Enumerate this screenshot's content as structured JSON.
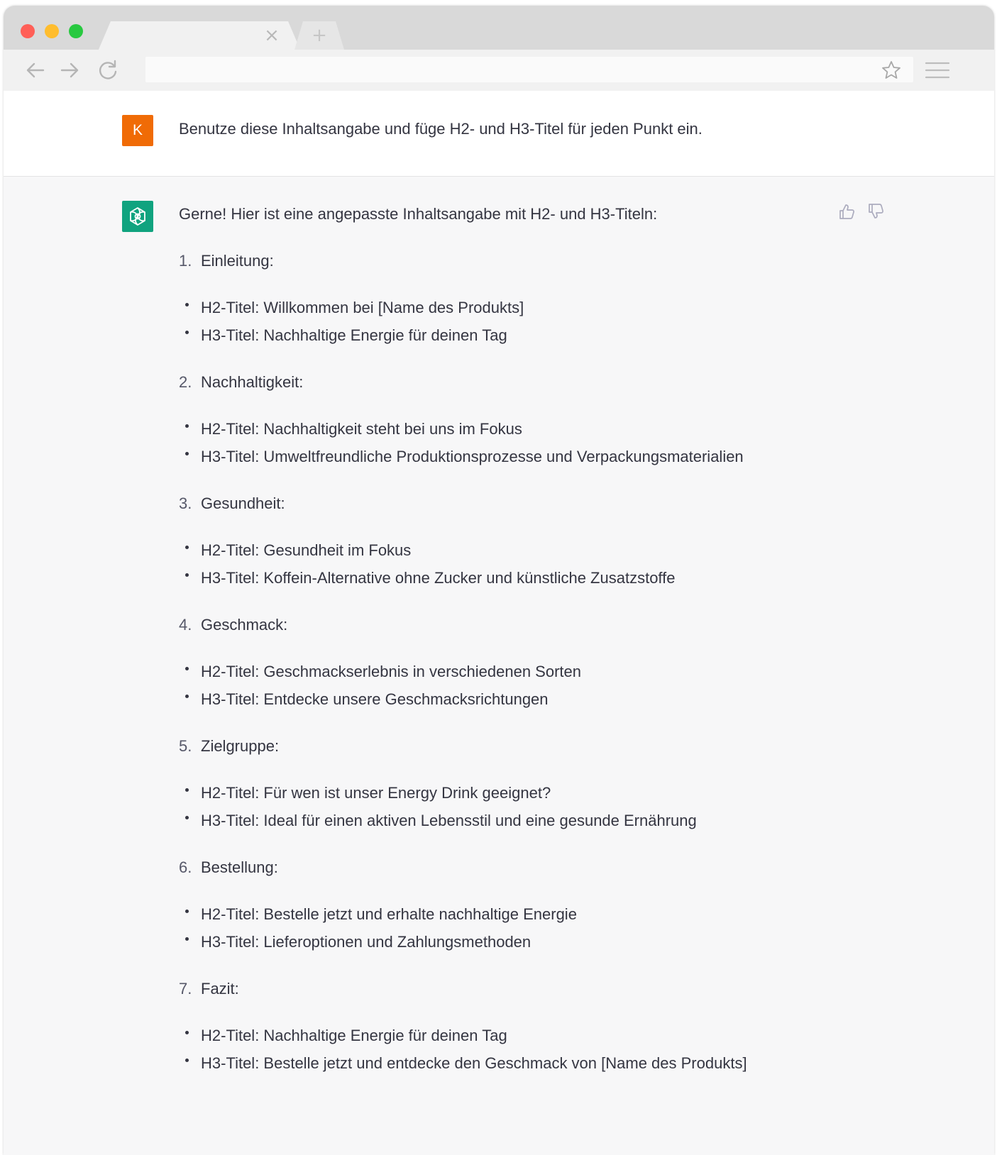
{
  "browser": {
    "traffic_lights": [
      {
        "name": "close",
        "color": "#ff5f57"
      },
      {
        "name": "minimize",
        "color": "#ffbd2e"
      },
      {
        "name": "maximize",
        "color": "#28c940"
      }
    ],
    "tab_close_glyph": "×",
    "new_tab_glyph": "+",
    "url": "",
    "icons": [
      "back-arrow-icon",
      "forward-arrow-icon",
      "reload-icon",
      "star-icon",
      "hamburger-menu-icon"
    ]
  },
  "chat": {
    "user": {
      "avatar_letter": "K",
      "avatar_color": "#f06b06",
      "message": "Benutze diese Inhaltsangabe und füge H2- und H3-Titel für jeden Punkt ein."
    },
    "assistant": {
      "avatar_color": "#10a37f",
      "avatar_icon": "openai-logo-icon",
      "intro": "Gerne! Hier ist eine angepasste Inhaltsangabe mit H2- und H3-Titeln:",
      "feedback_icons": [
        "thumbs-up-icon",
        "thumbs-down-icon"
      ],
      "sections": [
        {
          "number": "1.",
          "title": "Einleitung:",
          "items": [
            "H2-Titel: Willkommen bei [Name des Produkts]",
            "H3-Titel: Nachhaltige Energie für deinen Tag"
          ]
        },
        {
          "number": "2.",
          "title": "Nachhaltigkeit:",
          "items": [
            "H2-Titel: Nachhaltigkeit steht bei uns im Fokus",
            "H3-Titel: Umweltfreundliche Produktionsprozesse und Verpackungsmaterialien"
          ]
        },
        {
          "number": "3.",
          "title": "Gesundheit:",
          "items": [
            "H2-Titel: Gesundheit im Fokus",
            "H3-Titel: Koffein-Alternative ohne Zucker und künstliche Zusatzstoffe"
          ]
        },
        {
          "number": "4.",
          "title": "Geschmack:",
          "items": [
            "H2-Titel: Geschmackserlebnis in verschiedenen Sorten",
            "H3-Titel: Entdecke unsere Geschmacksrichtungen"
          ]
        },
        {
          "number": "5.",
          "title": "Zielgruppe:",
          "items": [
            "H2-Titel: Für wen ist unser Energy Drink geeignet?",
            "H3-Titel: Ideal für einen aktiven Lebensstil und eine gesunde Ernährung"
          ]
        },
        {
          "number": "6.",
          "title": "Bestellung:",
          "items": [
            "H2-Titel: Bestelle jetzt und erhalte nachhaltige Energie",
            "H3-Titel: Lieferoptionen und Zahlungsmethoden"
          ]
        },
        {
          "number": "7.",
          "title": "Fazit:",
          "items": [
            "H2-Titel: Nachhaltige Energie für deinen Tag",
            "H3-Titel: Bestelle jetzt und entdecke den Geschmack von [Name des Produkts]"
          ]
        }
      ]
    }
  }
}
